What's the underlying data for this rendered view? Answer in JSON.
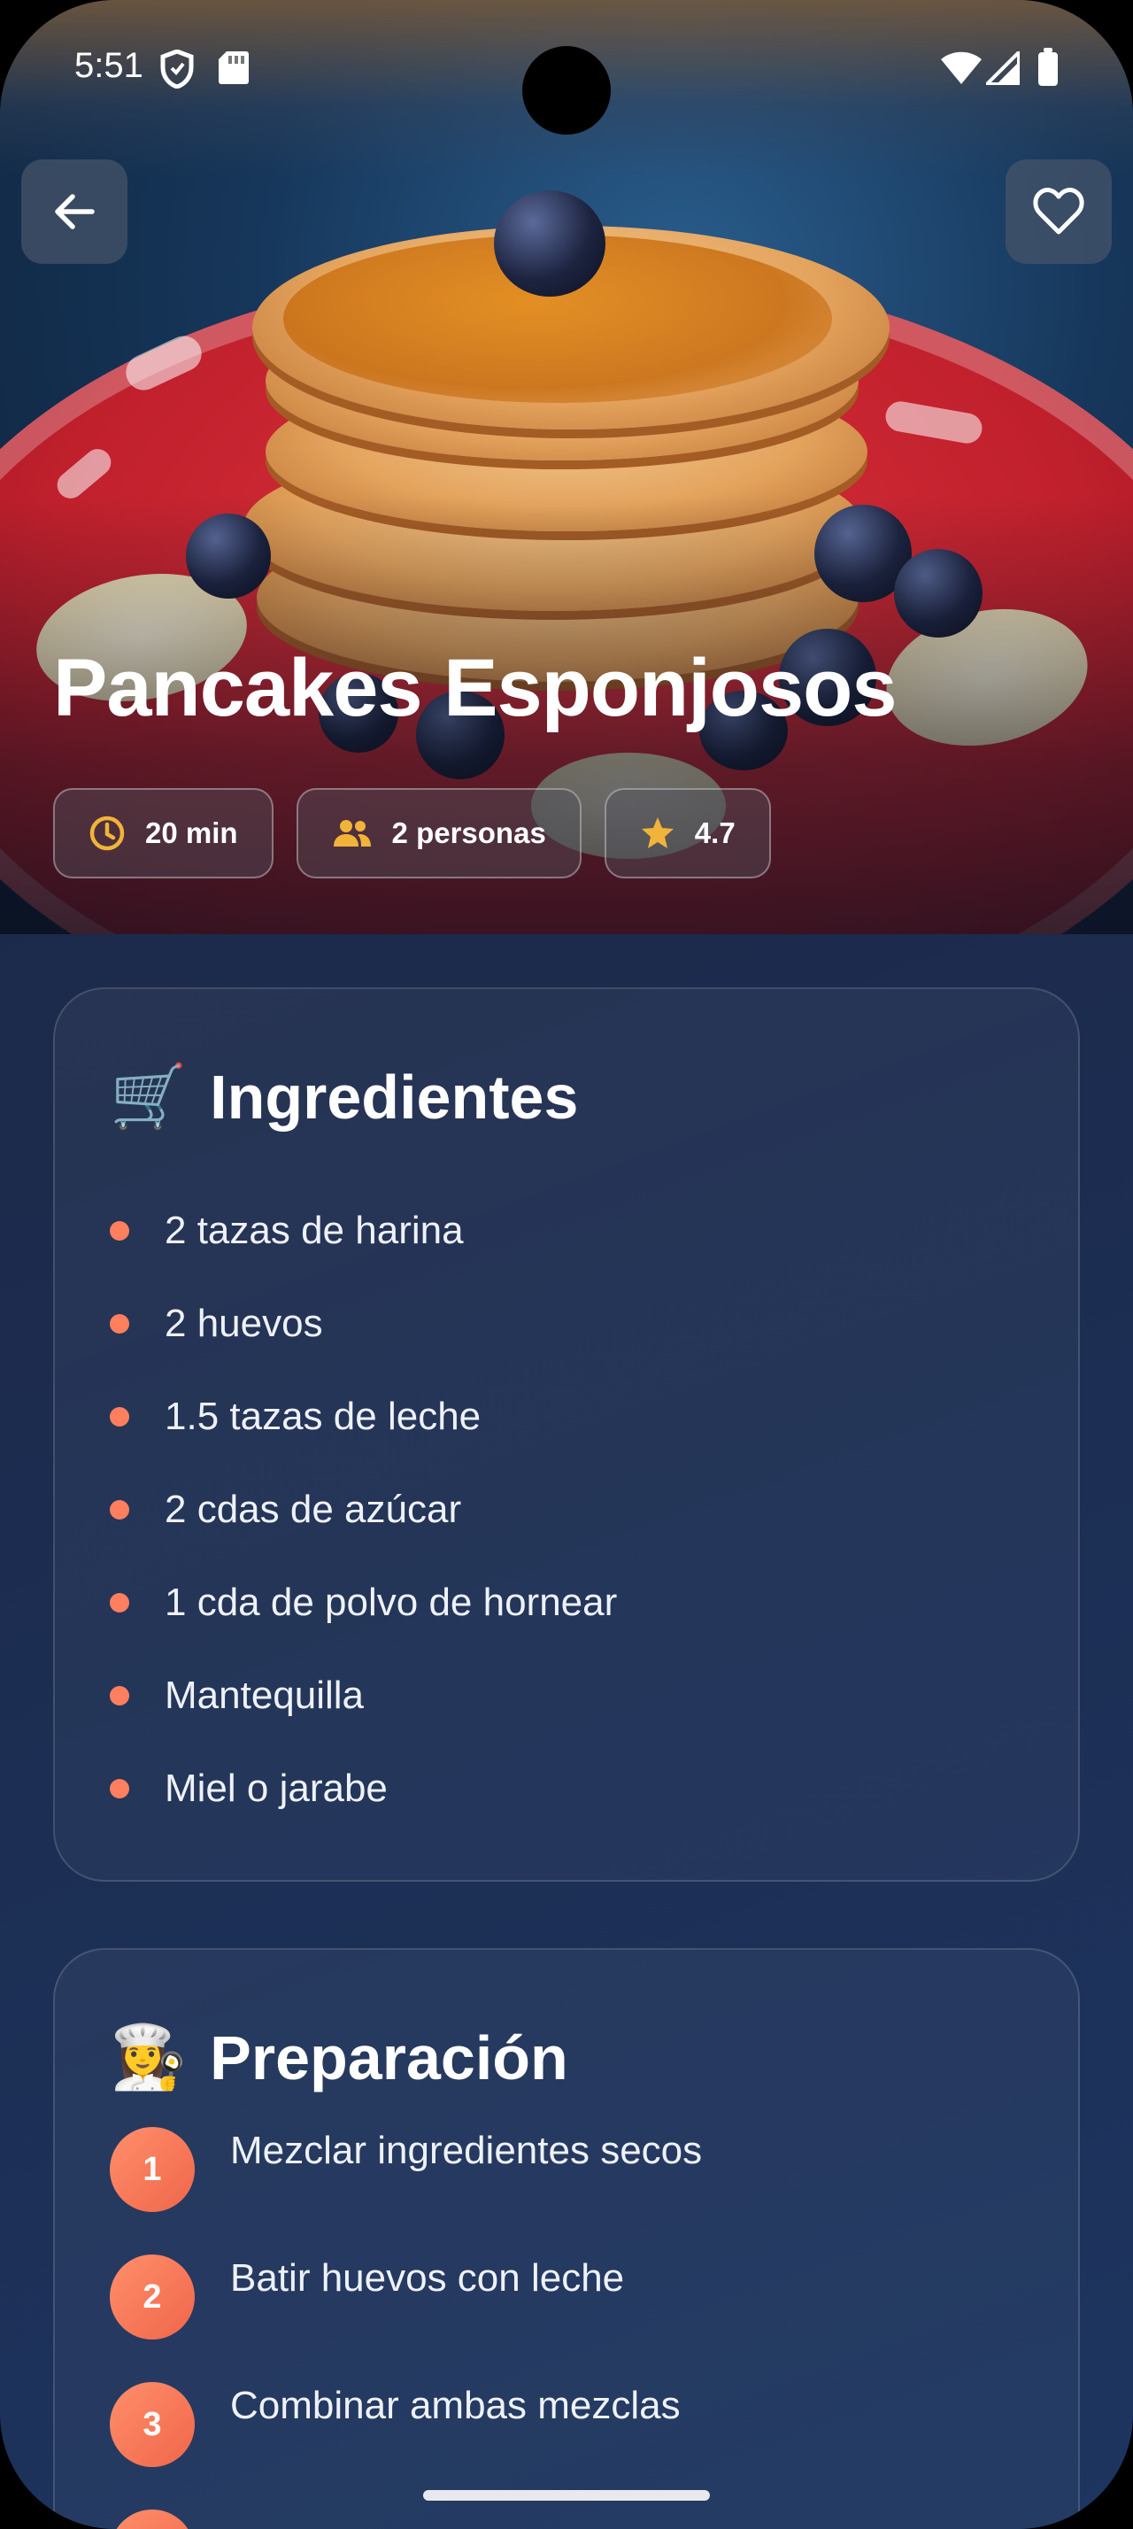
{
  "status_bar": {
    "time": "5:51"
  },
  "recipe": {
    "title": "Pancakes Esponjosos",
    "chips": {
      "time": "20 min",
      "servings": "2 personas",
      "rating": "4.7"
    }
  },
  "ingredients": {
    "emoji": "🛒",
    "title": "Ingredientes",
    "items": [
      "2 tazas de harina",
      "2 huevos",
      "1.5 tazas de leche",
      "2 cdas de azúcar",
      "1 cda de polvo de hornear",
      "Mantequilla",
      "Miel o jarabe"
    ]
  },
  "preparation": {
    "emoji": "👩‍🍳",
    "title": "Preparación",
    "steps": [
      {
        "number": "1",
        "text": "Mezclar ingredientes secos"
      },
      {
        "number": "2",
        "text": "Batir huevos con leche"
      },
      {
        "number": "3",
        "text": "Combinar ambas mezclas"
      }
    ]
  },
  "icons": {
    "back": "arrow-left-icon",
    "favorite": "heart-outline-icon",
    "time": "clock-icon",
    "servings": "people-icon",
    "rating": "star-icon"
  },
  "colors": {
    "accent": "#ff7f5f",
    "star": "#f2b33a",
    "background": "#1c2a4c"
  }
}
